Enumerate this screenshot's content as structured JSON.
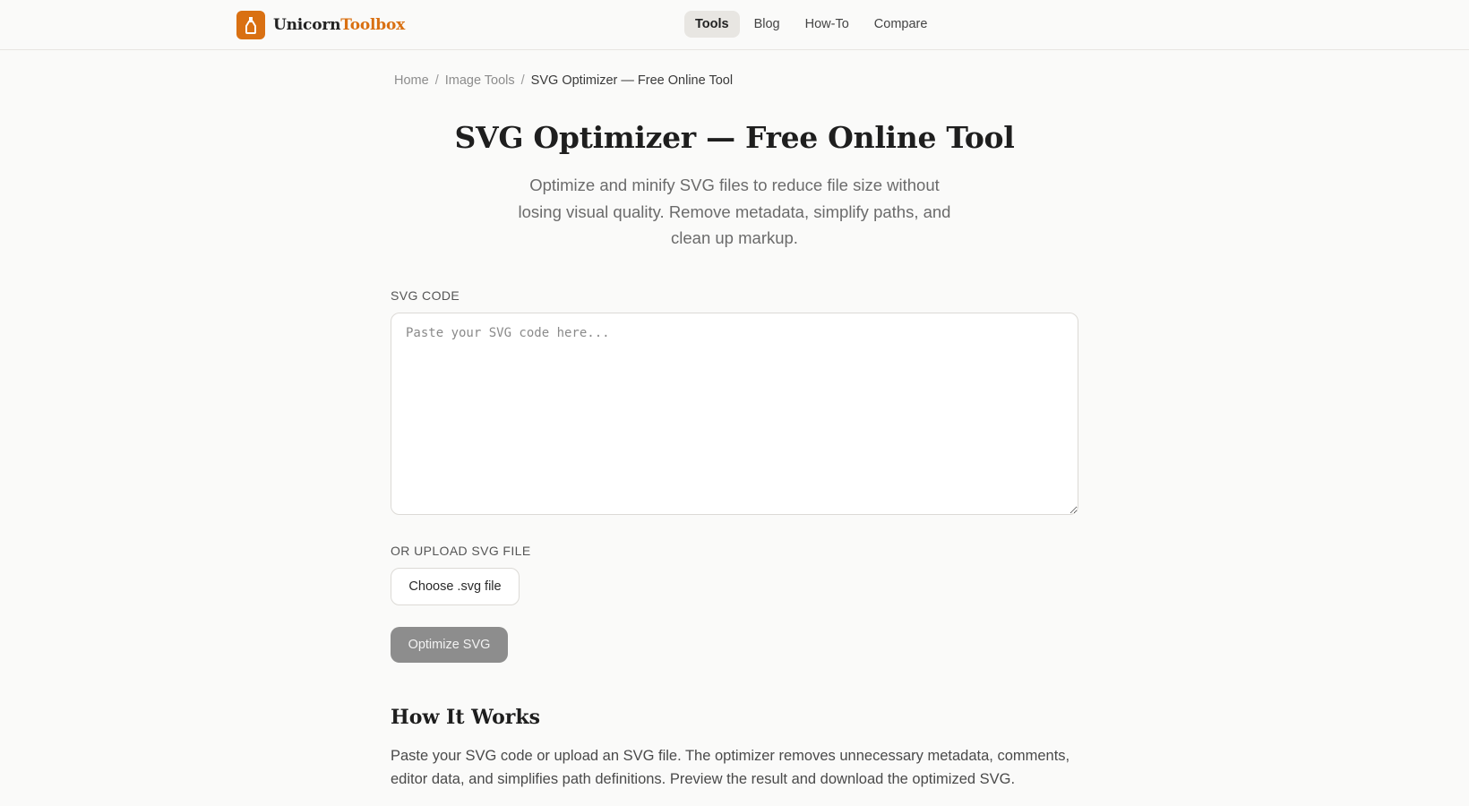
{
  "header": {
    "logo_part1": "Unicorn",
    "logo_part2": "Toolbox",
    "nav": [
      {
        "label": "Tools",
        "active": true
      },
      {
        "label": "Blog",
        "active": false
      },
      {
        "label": "How-To",
        "active": false
      },
      {
        "label": "Compare",
        "active": false
      }
    ],
    "accent_color": "#d97012"
  },
  "breadcrumb": {
    "items": [
      "Home",
      "Image Tools"
    ],
    "current": "SVG Optimizer — Free Online Tool",
    "separator": "/"
  },
  "page": {
    "title": "SVG Optimizer — Free Online Tool",
    "subtitle": "Optimize and minify SVG files to reduce file size without losing visual quality. Remove metadata, simplify paths, and clean up markup."
  },
  "form": {
    "code_label": "SVG CODE",
    "code_placeholder": "Paste your SVG code here...",
    "code_value": "",
    "upload_label": "OR UPLOAD SVG FILE",
    "upload_button": "Choose .svg file",
    "optimize_button": "Optimize SVG"
  },
  "how_it_works": {
    "heading": "How It Works",
    "text": "Paste your SVG code or upload an SVG file. The optimizer removes unnecessary metadata, comments, editor data, and simplifies path definitions. Preview the result and download the optimized SVG."
  }
}
